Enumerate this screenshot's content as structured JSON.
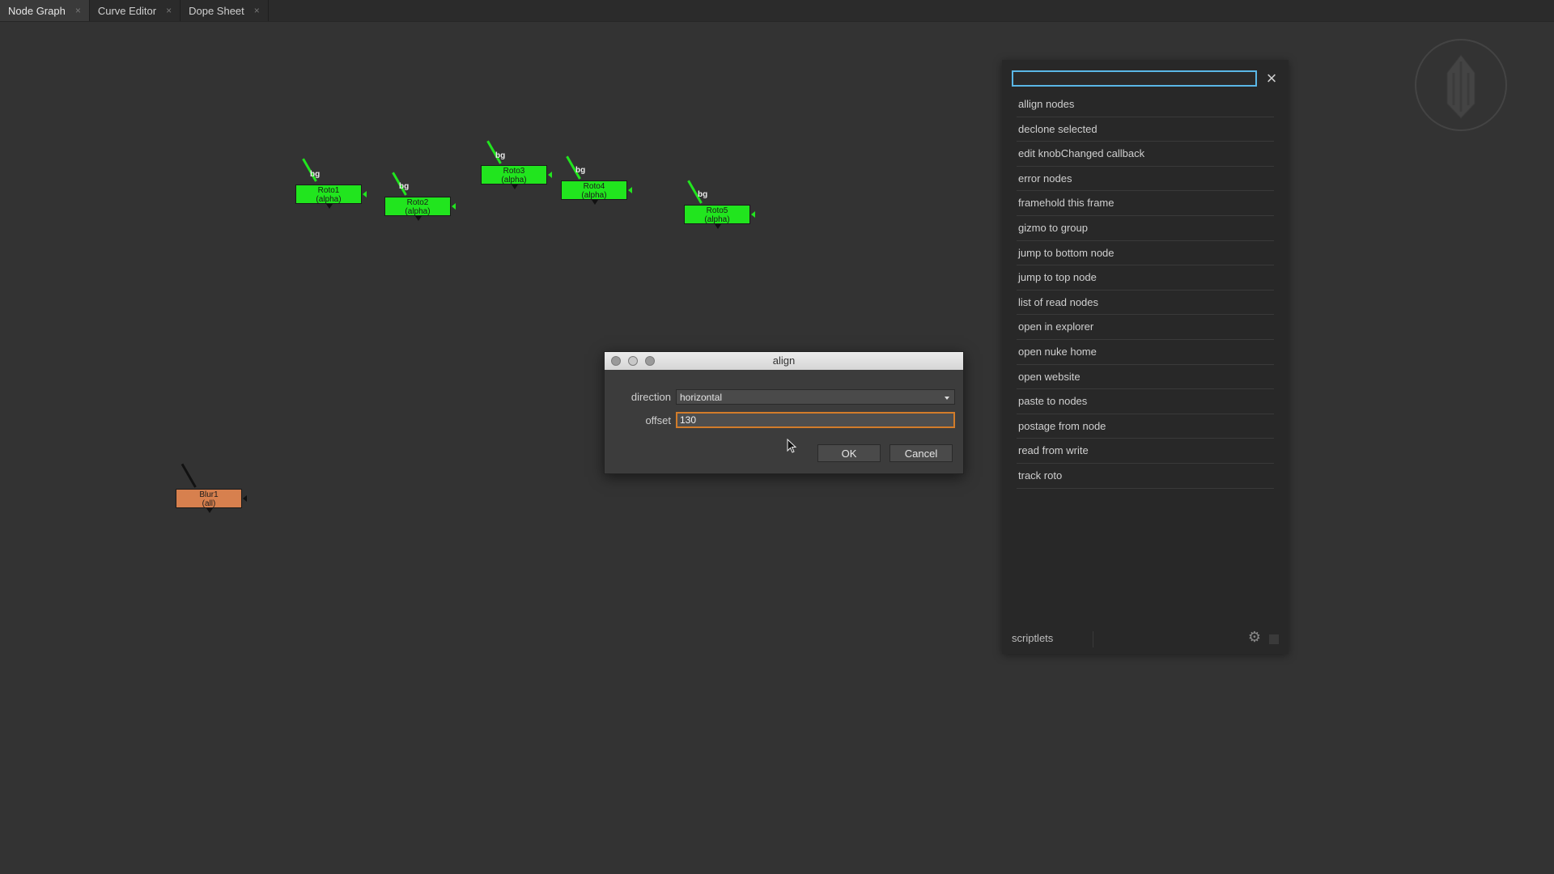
{
  "tabs": [
    {
      "label": "Node Graph",
      "close": "×"
    },
    {
      "label": "Curve Editor",
      "close": "×"
    },
    {
      "label": "Dope Sheet",
      "close": "×"
    }
  ],
  "nodes": {
    "roto1": {
      "name": "Roto1",
      "channel": "(alpha)",
      "input": "bg"
    },
    "roto2": {
      "name": "Roto2",
      "channel": "(alpha)",
      "input": "bg"
    },
    "roto3": {
      "name": "Roto3",
      "channel": "(alpha)",
      "input": "bg"
    },
    "roto4": {
      "name": "Roto4",
      "channel": "(alpha)",
      "input": "bg"
    },
    "roto5": {
      "name": "Roto5",
      "channel": "(alpha)",
      "input": "bg"
    },
    "blur1": {
      "name": "Blur1",
      "channel": "(all)"
    }
  },
  "dialog": {
    "title": "align",
    "direction_label": "direction",
    "direction_value": "horizontal",
    "offset_label": "offset",
    "offset_value": "130",
    "ok_label": "OK",
    "cancel_label": "Cancel"
  },
  "scriptlets": {
    "search_value": "",
    "close_icon": "×",
    "items": [
      "allign nodes",
      "declone selected",
      "edit knobChanged callback",
      "error nodes",
      "framehold this frame",
      "gizmo to group",
      "jump to bottom node",
      "jump to top node",
      "list of read nodes",
      "open in explorer",
      "open nuke home",
      "open website",
      "paste to nodes",
      "postage from node",
      "read from write",
      "track roto"
    ],
    "footer_label": "scriptlets",
    "gear_icon": "⚙"
  },
  "colors": {
    "roto": "#21e51e",
    "blur": "#d7804e",
    "search_border": "#5ab7e6",
    "offset_border": "#d27c2a"
  }
}
